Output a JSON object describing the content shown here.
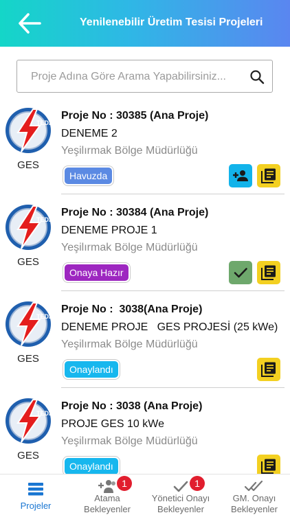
{
  "header": {
    "title": "Yenilenebilir Üretim Tesisi Projeleri"
  },
  "search": {
    "placeholder": "Proje Adına Göre Arama Yapabilirsiniz..."
  },
  "projects": [
    {
      "project_no": "Proje No : 30385 (Ana Proje)",
      "name": "DENEME 2",
      "department": "Yeşilırmak Bölge Müdürlüğü",
      "type": "GES",
      "status": "Havuzda",
      "logo_text": "TEDAŞ"
    },
    {
      "project_no": "Proje No : 30384 (Ana Proje)",
      "name": "DENEME PROJE 1",
      "department": "Yeşilırmak Bölge Müdürlüğü",
      "type": "GES",
      "status": "Onaya Hazır",
      "logo_text": "TEDAŞ"
    },
    {
      "project_no": "Proje No :  3038(Ana Proje)",
      "name": "DENEME PROJE   GES PROJESİ (25 kWe)",
      "department": "Yeşilırmak Bölge Müdürlüğü",
      "type": "GES",
      "status": "Onaylandı",
      "logo_text": "TEDAŞ"
    },
    {
      "project_no": "Proje No : 3038 (Ana Proje)",
      "name": "PROJE GES 10 kWe",
      "department": "Yeşilırmak Bölge Müdürlüğü",
      "type": "GES",
      "status": "Onaylandı",
      "logo_text": "TEDAŞ"
    }
  ],
  "nav": {
    "tabs": [
      {
        "label": "Projeler",
        "badge": null
      },
      {
        "label": "Atama\nBekleyenler",
        "line1": "Atama",
        "line2": "Bekleyenler",
        "badge": "1"
      },
      {
        "label": "Yönetici Onayı\nBekleyenler",
        "line1": "Yönetici Onayı",
        "line2": "Bekleyenler",
        "badge": "1"
      },
      {
        "label": "GM. Onayı\nBekleyenler",
        "line1": "GM. Onayı",
        "line2": "Bekleyenler",
        "badge": null
      }
    ]
  },
  "colors": {
    "header_gradient_start": "#14d6c8",
    "header_gradient_end": "#5a86f0",
    "status_havuzda": "#5b8ae3",
    "status_onaya_hazir": "#9d27c0",
    "status_onaylandi": "#17b7ee",
    "assign_button": "#12b3ea",
    "approve_button": "#6ea86c",
    "document_button": "#f3d021",
    "active_tab": "#1976d2",
    "notification": "#e11e2e"
  },
  "icons": {
    "back": "arrow-left-icon",
    "search": "search-icon",
    "assign": "person-add-icon",
    "approve": "check-icon",
    "document": "document-icon",
    "projects_tab": "list-icon",
    "assign_tab": "group-add-icon",
    "manager_tab": "check-icon",
    "gm_tab": "double-check-icon"
  }
}
